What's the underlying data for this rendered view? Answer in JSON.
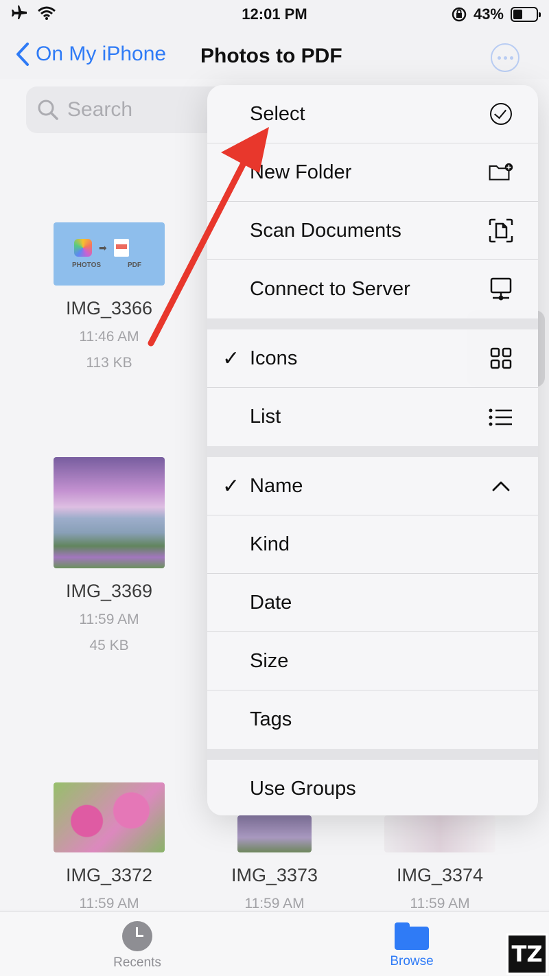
{
  "status_bar": {
    "time": "12:01 PM",
    "battery_percent": "43%",
    "battery_level": 0.43
  },
  "nav": {
    "back_label": "On My iPhone",
    "title": "Photos to PDF"
  },
  "search": {
    "placeholder": "Search"
  },
  "files": [
    {
      "name": "IMG_3366",
      "time": "11:46 AM",
      "size": "113 KB",
      "thumb_labels": [
        "PHOTOS",
        "PDF"
      ]
    },
    {
      "name": "IMG_3369",
      "time": "11:59 AM",
      "size": "45 KB"
    },
    {
      "name": "IMG_3372",
      "time": "11:59 AM"
    },
    {
      "name": "IMG_3373",
      "time": "11:59 AM"
    },
    {
      "name": "IMG_3374",
      "time": "11:59 AM"
    }
  ],
  "menu": {
    "actions": [
      "Select",
      "New Folder",
      "Scan Documents",
      "Connect to Server"
    ],
    "view": [
      "Icons",
      "List"
    ],
    "sort": [
      "Name",
      "Kind",
      "Date",
      "Size",
      "Tags"
    ],
    "groups": "Use Groups",
    "checkmark": "✓"
  },
  "tabs": {
    "recents": "Recents",
    "browse": "Browse"
  },
  "colors": {
    "accent": "#2f7bf6",
    "arrow": "#e8372c"
  },
  "watermark": "TZ"
}
